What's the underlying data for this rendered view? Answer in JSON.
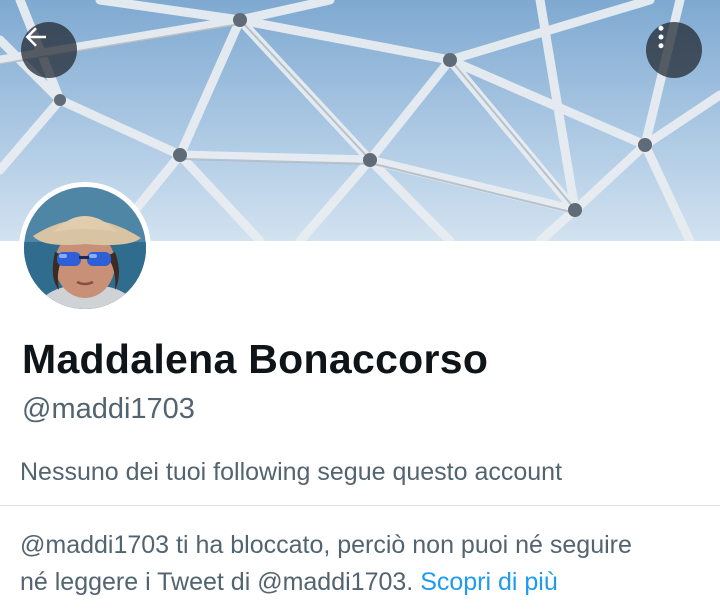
{
  "header": {
    "back_icon": "arrow-left-icon",
    "more_icon": "more-vertical-icon"
  },
  "profile": {
    "name": "Maddalena Bonaccorso",
    "handle": "@maddi1703",
    "following_note": "Nessuno dei tuoi following segue questo account"
  },
  "blocked_notice": {
    "line1": "@maddi1703 ti ha bloccato, perciò non puoi né seguire",
    "line2": "né leggere i Tweet di @maddi1703.",
    "link_label": "Scopri di più"
  },
  "colors": {
    "accent": "#1d9bf0",
    "secondary_text": "#536471",
    "primary_text": "#0f1419"
  }
}
